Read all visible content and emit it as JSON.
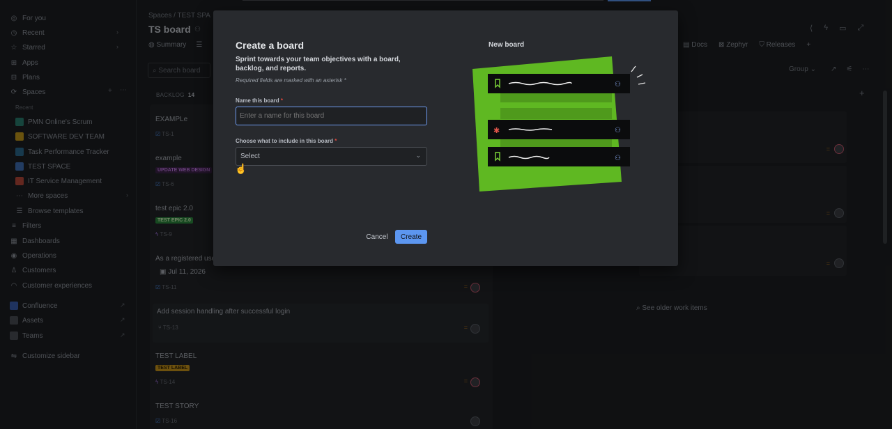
{
  "sidebar": {
    "items": [
      {
        "label": "For you",
        "icon": "user-circle-icon"
      },
      {
        "label": "Recent",
        "icon": "clock-icon"
      },
      {
        "label": "Starred",
        "icon": "star-icon"
      },
      {
        "label": "Apps",
        "icon": "apps-icon"
      },
      {
        "label": "Plans",
        "icon": "plans-icon"
      },
      {
        "label": "Spaces",
        "icon": "spaces-icon"
      }
    ],
    "recent_label": "Recent",
    "spaces": [
      {
        "label": "PMN Online's Scrum",
        "color": "#2a7f6f"
      },
      {
        "label": "SOFTWARE DEV TEAM",
        "color": "#c49a1a"
      },
      {
        "label": "Task Performance Tracker",
        "color": "#2b6a8f"
      },
      {
        "label": "TEST SPACE",
        "color": "#3f6fb5"
      },
      {
        "label": "IT Service Management",
        "color": "#b8483a"
      }
    ],
    "more_spaces": "More spaces",
    "browse_templates": "Browse templates",
    "lower": [
      {
        "label": "Filters",
        "icon": "filter-icon"
      },
      {
        "label": "Dashboards",
        "icon": "dashboard-icon"
      },
      {
        "label": "Operations",
        "icon": "operations-icon"
      },
      {
        "label": "Customers",
        "icon": "customers-icon"
      },
      {
        "label": "Customer experiences",
        "icon": "headset-icon"
      }
    ],
    "apps": [
      {
        "label": "Confluence",
        "icon": "confluence-icon"
      },
      {
        "label": "Assets",
        "icon": "assets-icon"
      },
      {
        "label": "Teams",
        "icon": "teams-icon"
      }
    ],
    "customize": "Customize sidebar"
  },
  "header": {
    "breadcrumb_spaces": "Spaces",
    "breadcrumb_sep": "/",
    "breadcrumb_space": "TEST SPA",
    "title": "TS board",
    "tab_summary": "Summary",
    "tab_docs": "Docs",
    "tab_zephyr": "Zephyr",
    "tab_releases": "Releases",
    "search_placeholder": "Search board",
    "group_label": "Group"
  },
  "backlog": {
    "heading": "BACKLOG",
    "count": "14",
    "cards": [
      {
        "title": "EXAMPLe",
        "key": "TS-1"
      },
      {
        "title": "example",
        "key": "TS-6",
        "lozenge": "UPDATE WEB DESIGN"
      },
      {
        "title": "test epic 2.0",
        "key": "TS-9",
        "lozenge": "TEST EPIC 2.0"
      },
      {
        "title": "As a registered use",
        "key": "TS-11",
        "date": "Jul 11, 2026"
      },
      {
        "title": "Add session handling after successful login",
        "key": "TS-13"
      },
      {
        "title": "TEST LABEL",
        "key": "TS-14",
        "lozenge": "TEST LABEL"
      },
      {
        "title": "TEST STORY",
        "key": "TS-16"
      }
    ]
  },
  "older_items": "See older work items",
  "modal": {
    "title": "Create a board",
    "description": "Sprint towards your team objectives with a board, backlog, and reports.",
    "required_note": "Required fields are marked with an asterisk *",
    "name_label": "Name this board",
    "name_placeholder": "Enter a name for this board",
    "include_label": "Choose what to include in this board",
    "select_value": "Select",
    "asterisk": "*",
    "cancel": "Cancel",
    "create": "Create",
    "preview_label": "New board"
  },
  "colors": {
    "accent": "#5c96f0",
    "green": "#5fb822",
    "required": "#e2483d"
  }
}
